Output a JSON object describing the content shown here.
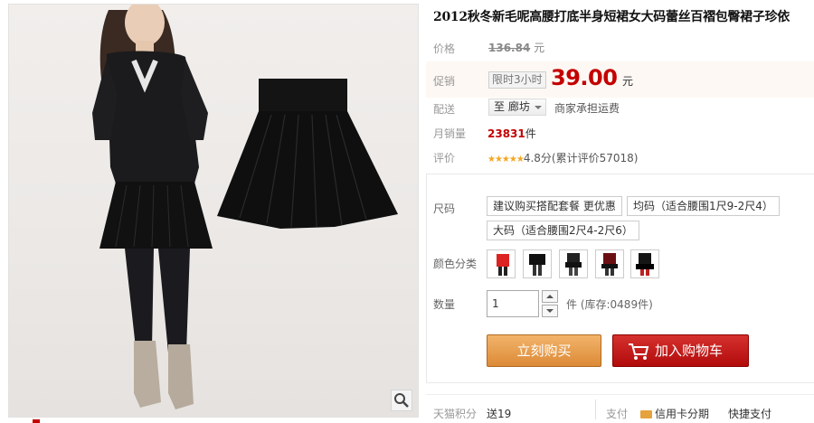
{
  "product": {
    "title": "2012秋冬新毛呢高腰打底半身短裙女大码蕾丝百褶包臀裙子珍依"
  },
  "price": {
    "label": "价格",
    "original": "136.84",
    "unit": "元"
  },
  "promo": {
    "label": "促销",
    "tag": "限时3小时",
    "price": "39.00",
    "unit": "元"
  },
  "shipping": {
    "label": "配送",
    "select_value": "至  廊坊",
    "note": "商家承担运费"
  },
  "sales": {
    "label": "月销量",
    "count": "23831",
    "unit": "件"
  },
  "rating": {
    "label": "评价",
    "stars": "★★★★★",
    "text": "4.8分(累计评价57018)",
    "score": 4.8
  },
  "size": {
    "label": "尺码",
    "options": [
      "建议购买搭配套餐 更优惠",
      "均码（适合腰围1尺9-2尺4）",
      "大码（适合腰围2尺4-2尺6）"
    ]
  },
  "color": {
    "label": "颜色分类",
    "swatch_count_note": "5 variants",
    "swatches": [
      "red-variant",
      "black-variant-1",
      "black-variant-2",
      "dark-red-variant",
      "black-variant-3"
    ]
  },
  "quantity": {
    "label": "数量",
    "value": "1",
    "stock_text": "件 (库存:0489件)"
  },
  "actions": {
    "buy_now": "立刻购买",
    "add_to_cart": "加入购物车"
  },
  "footer": {
    "points_label": "天猫积分",
    "points_value": "送19",
    "pay_label": "支付",
    "pay_option_1": "信用卡分期",
    "pay_option_2": "快捷支付"
  },
  "icons": {
    "zoom": "magnifier-icon",
    "cart": "cart-icon",
    "dropdown": "chevron-down-icon"
  },
  "colors": {
    "price_red": "#c40000",
    "buy_orange": "#e6953f",
    "cart_red": "#c41a1a",
    "star_gold": "#f5a623"
  }
}
